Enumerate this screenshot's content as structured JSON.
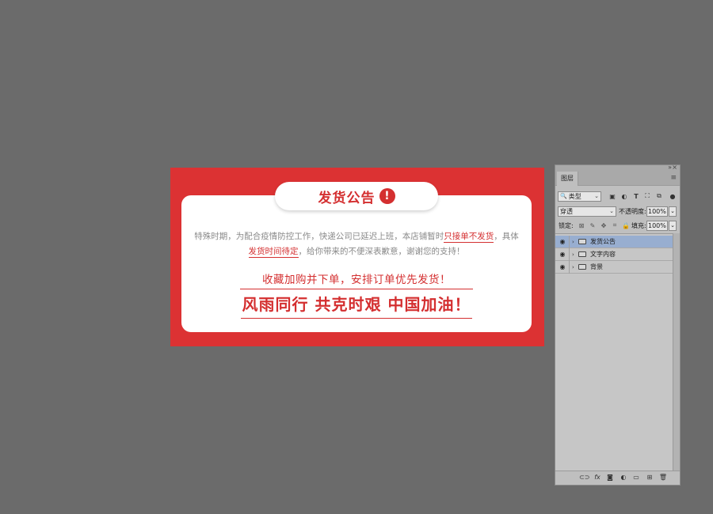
{
  "artwork": {
    "title": "发货公告",
    "alert_glyph": "!",
    "body_before": "特殊时期，为配合疫情防控工作，快递公司已延迟上班，本店铺暂时",
    "body_hl1": "只接单不发货",
    "body_mid": "，具体",
    "body_hl2": "发货时间待定",
    "body_after": "，给你带来的不便深表歉意，谢谢您的支持！",
    "line2": "收藏加购并下单，安排订单优先发货！",
    "line3": "风雨同行 共克时艰 中国加油！",
    "colors": {
      "background_red": "#dc3233",
      "accent_red": "#d42f30",
      "card": "#ffffff",
      "body_gray": "#8a8a8a"
    }
  },
  "layers_panel": {
    "tab_label": "图层",
    "filter": {
      "value": "类型",
      "search_icon": "🔍"
    },
    "filter_icons": [
      "image-filter-icon",
      "adjustment-filter-icon",
      "type-filter-icon",
      "shape-filter-icon",
      "smart-object-filter-icon",
      "filter-toggle-icon"
    ],
    "blend_mode": "穿透",
    "opacity_label": "不透明度:",
    "opacity_value": "100%",
    "lock_label": "锁定:",
    "fill_label": "填充:",
    "fill_value": "100%",
    "layers": [
      {
        "name": "发货公告",
        "selected": true
      },
      {
        "name": "文字内容",
        "selected": false
      },
      {
        "name": "背景",
        "selected": false
      }
    ],
    "footer_icons": [
      "link-layers-icon",
      "fx-icon",
      "mask-icon",
      "adjustment-icon",
      "group-icon",
      "new-layer-icon",
      "delete-icon"
    ],
    "fx_text": "fx"
  }
}
